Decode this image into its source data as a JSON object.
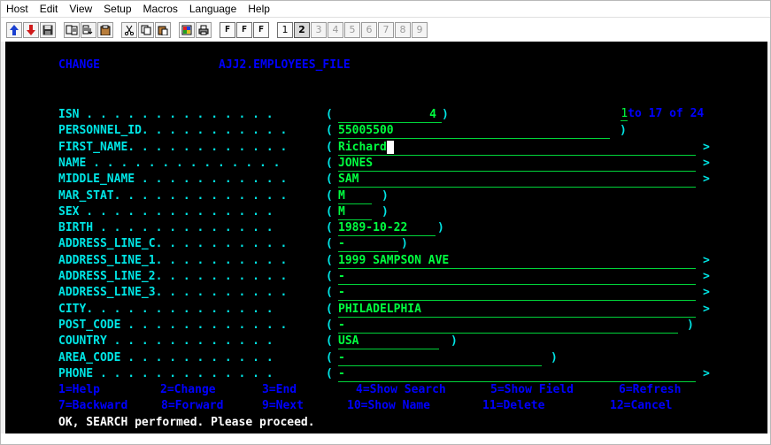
{
  "menubar": [
    "Host",
    "Edit",
    "View",
    "Setup",
    "Macros",
    "Language",
    "Help"
  ],
  "toolbar": {
    "nav_icons": [
      "arrow-up-icon",
      "arrow-down-icon",
      "save-icon"
    ],
    "edit_icons": [
      "copy-text-icon",
      "paste-text-icon",
      "clipboard-icon"
    ],
    "clip_icons": [
      "cut-icon",
      "copy-icon",
      "paste-icon"
    ],
    "misc_icons": [
      "palette-icon",
      "print-icon"
    ],
    "font_buttons": [
      "F",
      "F",
      "F"
    ],
    "session_tabs": [
      "1",
      "2",
      "3",
      "4",
      "5",
      "6",
      "7",
      "8",
      "9"
    ]
  },
  "screen": {
    "mode": "CHANGE",
    "file": "AJJ2.EMPLOYEES_FILE",
    "pager": {
      "current": "1",
      "rest": "to 17 of 24"
    },
    "fields": [
      {
        "label": "ISN",
        "dots": " . . . . . . . . . . . . . .",
        "value": "4",
        "close": ")",
        "more": ""
      },
      {
        "label": "PERSONNEL_ID",
        "dots": ". . . . . . . . . . .",
        "value": "55005500",
        "close": ")",
        "more": ""
      },
      {
        "label": "FIRST_NAME",
        "dots": ". . . . . . . . . . . .",
        "value": "Richard",
        "close": "",
        "more": ">"
      },
      {
        "label": "NAME",
        "dots": " . . . . . . . . . . . . . .",
        "value": "JONES",
        "close": "",
        "more": ">"
      },
      {
        "label": "MIDDLE_NAME",
        "dots": " . . . . . . . . . . .",
        "value": "SAM",
        "close": "",
        "more": ">"
      },
      {
        "label": "MAR_STAT",
        "dots": ". . . . . . . . . . . . .",
        "value": "M",
        "close": ")",
        "more": ""
      },
      {
        "label": "SEX",
        "dots": " . . . . . . . . . . . . . .",
        "value": "M",
        "close": ")",
        "more": ""
      },
      {
        "label": "BIRTH",
        "dots": " . . . . . . . . . . . . .",
        "value": "1989-10-22",
        "close": ")",
        "more": ""
      },
      {
        "label": "ADDRESS_LINE_C",
        "dots": ". . . . . . . . . .",
        "value": "-",
        "close": ")",
        "more": ""
      },
      {
        "label": "ADDRESS_LINE_1",
        "dots": ". . . . . . . . . .",
        "value": "1999 SAMPSON AVE",
        "close": "",
        "more": ">"
      },
      {
        "label": "ADDRESS_LINE_2",
        "dots": ". . . . . . . . . .",
        "value": "-",
        "close": "",
        "more": ">"
      },
      {
        "label": "ADDRESS_LINE_3",
        "dots": ". . . . . . . . . .",
        "value": "-",
        "close": "",
        "more": ">"
      },
      {
        "label": "CITY",
        "dots": ". . . . . . . . . . . . . .",
        "value": "PHILADELPHIA",
        "close": "",
        "more": ">"
      },
      {
        "label": "POST_CODE",
        "dots": " . . . . . . . . . . . .",
        "value": "-",
        "close": ")",
        "more": ""
      },
      {
        "label": "COUNTRY",
        "dots": " . . . . . . . . . . . .",
        "value": "USA",
        "close": ")",
        "more": ""
      },
      {
        "label": "AREA_CODE",
        "dots": " . . . . . . . . . . .",
        "value": "-",
        "close": ")",
        "more": ""
      },
      {
        "label": "PHONE",
        "dots": " . . . . . . . . . . . . .",
        "value": "-",
        "close": "",
        "more": ">"
      }
    ],
    "pf_row1": [
      "1=Help",
      "2=Change",
      "3=End",
      "4=Show Search",
      "5=Show Field",
      "6=Refresh"
    ],
    "pf_row2": [
      "7=Backward",
      "8=Forward",
      "9=Next",
      "10=Show Name",
      "11=Delete",
      "12=Cancel"
    ],
    "message": "OK, SEARCH performed. Please proceed."
  },
  "colors": {
    "background": "#000000",
    "label": "#00e5e5",
    "value": "#00ff40",
    "header": "#0000ff",
    "message": "#ffffff"
  }
}
